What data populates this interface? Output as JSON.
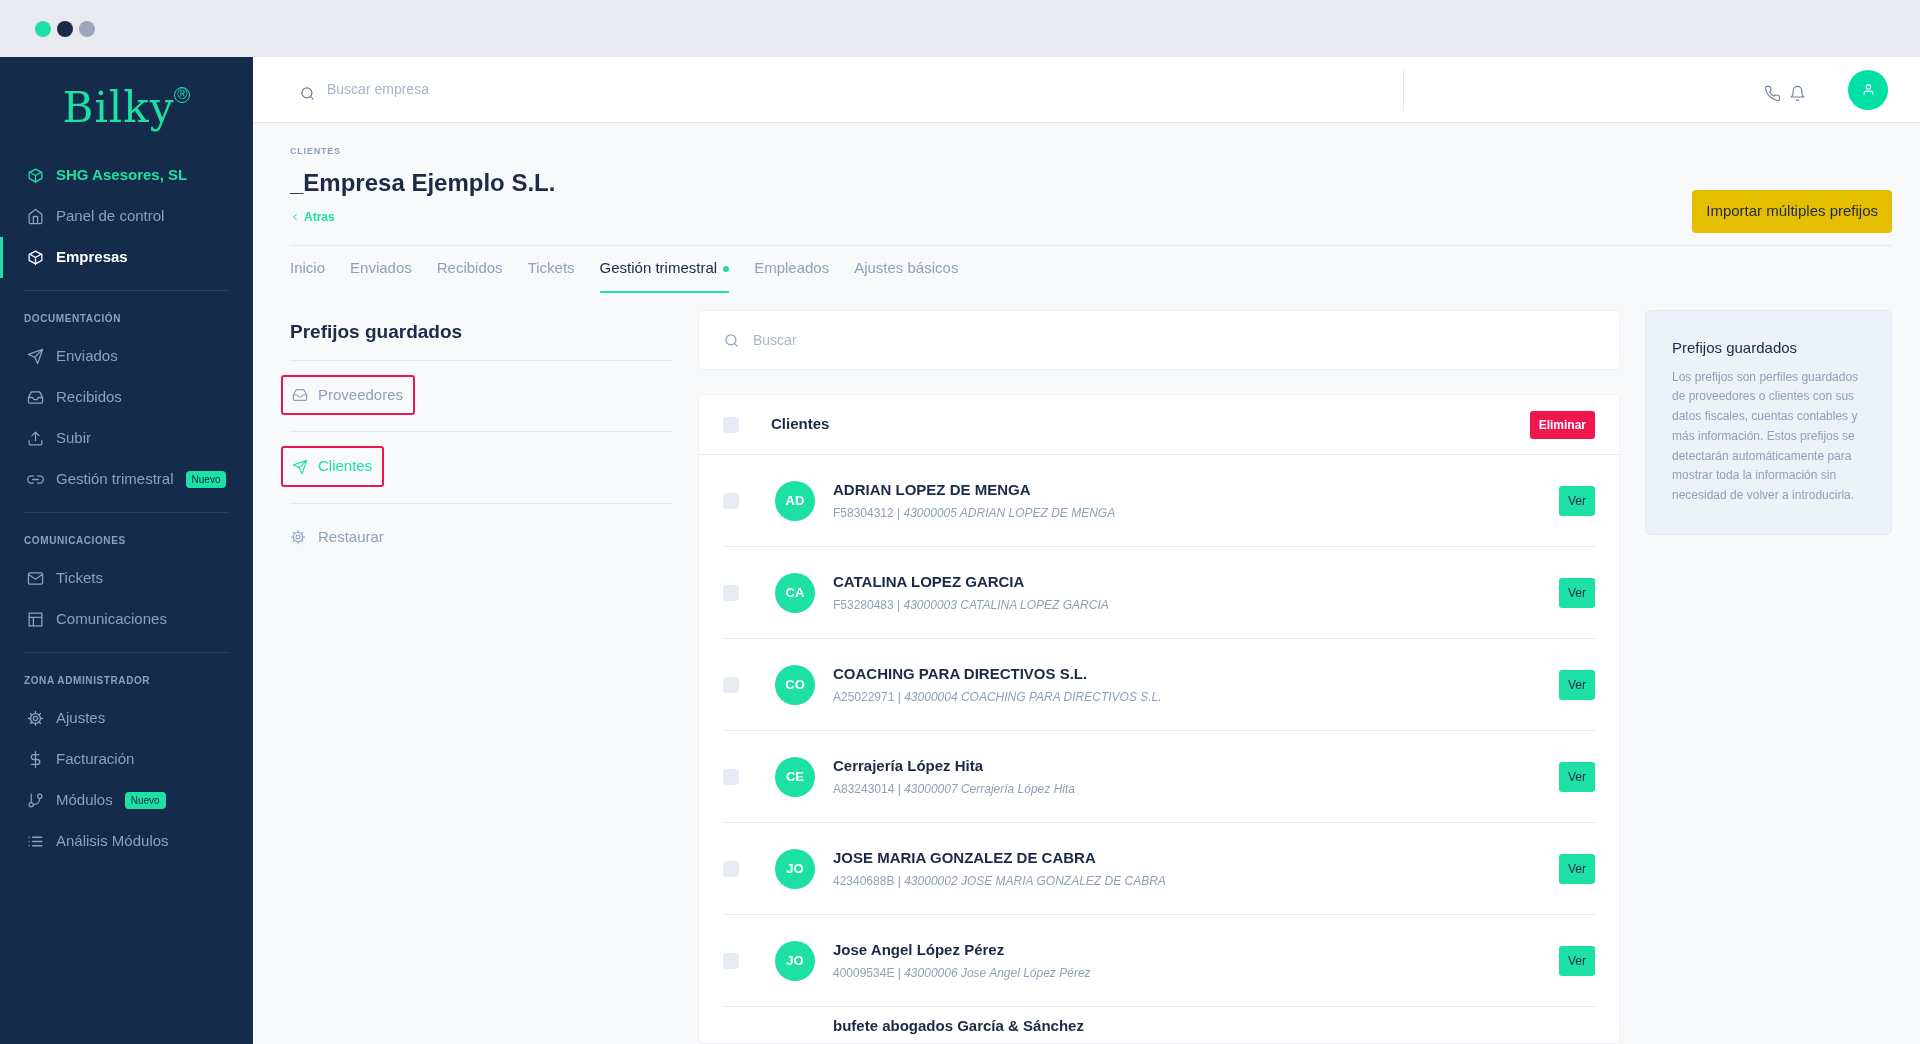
{
  "window": {
    "dots": [
      {
        "color": "#1de0a5"
      },
      {
        "color": "#1b2a47"
      },
      {
        "color": "#9aa7bb"
      }
    ]
  },
  "sidebar": {
    "logo": {
      "text": "Bilky",
      "mark": "®"
    },
    "groups": [
      {
        "items": [
          {
            "label": "SHG Asesores, SL",
            "kind": "account",
            "selected": false
          },
          {
            "label": "Panel de control",
            "kind": "link",
            "selected": false
          },
          {
            "label": "Empresas",
            "kind": "link",
            "selected": true
          }
        ]
      },
      {
        "heading": "DOCUMENTACIÓN",
        "items": [
          {
            "label": "Enviados",
            "kind": "link",
            "selected": false
          },
          {
            "label": "Recibidos",
            "kind": "link",
            "selected": false
          },
          {
            "label": "Subir",
            "kind": "link",
            "selected": false
          },
          {
            "label": "Gestión trimestral",
            "kind": "link",
            "selected": false,
            "badge": "Nuevo"
          }
        ]
      },
      {
        "heading": "COMUNICACIONES",
        "items": [
          {
            "label": "Tickets",
            "kind": "link",
            "selected": false
          },
          {
            "label": "Comunicaciones",
            "kind": "link",
            "selected": false
          }
        ]
      },
      {
        "heading": "ZONA ADMINISTRADOR",
        "items": [
          {
            "label": "Ajustes",
            "kind": "link",
            "selected": false
          },
          {
            "label": "Facturación",
            "kind": "link",
            "selected": false
          },
          {
            "label": "Módulos",
            "kind": "link",
            "selected": false,
            "badge": "Nuevo"
          },
          {
            "label": "Análisis Módulos",
            "kind": "link",
            "selected": false
          }
        ]
      }
    ]
  },
  "header": {
    "search": {
      "placeholder": "Buscar empresa"
    }
  },
  "page": {
    "breadcrumb": "CLIENTES",
    "title": "_Empresa Ejemplo S.L.",
    "back": "Atras",
    "import_button": "Importar múltiples prefijos"
  },
  "tabs": [
    {
      "label": "Inicio",
      "selected": false,
      "dot": false
    },
    {
      "label": "Enviados",
      "selected": false,
      "dot": false
    },
    {
      "label": "Recibidos",
      "selected": false,
      "dot": false
    },
    {
      "label": "Tickets",
      "selected": false,
      "dot": false
    },
    {
      "label": "Gestión trimestral",
      "selected": true,
      "dot": true
    },
    {
      "label": "Empleados",
      "selected": false,
      "dot": false
    },
    {
      "label": "Ajustes básicos",
      "selected": false,
      "dot": false
    }
  ],
  "prefixes": {
    "title": "Prefijos guardados",
    "items": [
      {
        "label": "Proveedores",
        "selected": false,
        "outlined": true
      },
      {
        "label": "Clientes",
        "selected": true,
        "outlined": true
      }
    ],
    "restore": "Restaurar"
  },
  "list": {
    "search": {
      "placeholder": "Buscar"
    },
    "header": {
      "label": "Clientes",
      "checked": false
    },
    "delete_button": "Eliminar",
    "rows": [
      {
        "initials": "AD",
        "name": "ADRIAN LOPEZ DE MENGA",
        "detail": "F58304312 | *43000005 ADRIAN LOPEZ DE MENGA*",
        "checked": false,
        "action": "Ver"
      },
      {
        "initials": "CA",
        "name": "CATALINA LOPEZ GARCIA",
        "detail": "F53280483 | *43000003 CATALINA LOPEZ GARCIA*",
        "checked": false,
        "action": "Ver"
      },
      {
        "initials": "CO",
        "name": "COACHING PARA DIRECTIVOS S.L.",
        "detail": "A25022971 | *43000004 COACHING PARA DIRECTIVOS S.L.*",
        "checked": false,
        "action": "Ver"
      },
      {
        "initials": "CE",
        "name": "Cerrajería López Hita",
        "detail": "A83243014 | *43000007 Cerrajería López Hita*",
        "checked": false,
        "action": "Ver"
      },
      {
        "initials": "JO",
        "name": "JOSE MARIA GONZALEZ DE CABRA",
        "detail": "42340688B | *43000002 JOSE MARIA GONZALEZ DE CABRA*",
        "checked": false,
        "action": "Ver"
      },
      {
        "initials": "JO",
        "name": "Jose Angel López Pérez",
        "detail": "40009534E | *43000006 Jose Angel López Pérez*",
        "checked": false,
        "action": "Ver"
      },
      {
        "name": "bufete abogados García & Sánchez"
      }
    ]
  },
  "info": {
    "title": "Prefijos guardados",
    "text": "Los prefijos son perfiles guardados de proveedores o clientes con sus datos fiscales, cuentas contables y más información. Estos prefijos se detectarán automáticamente para mostrar toda la información sin necesidad de volver a introducirla."
  }
}
